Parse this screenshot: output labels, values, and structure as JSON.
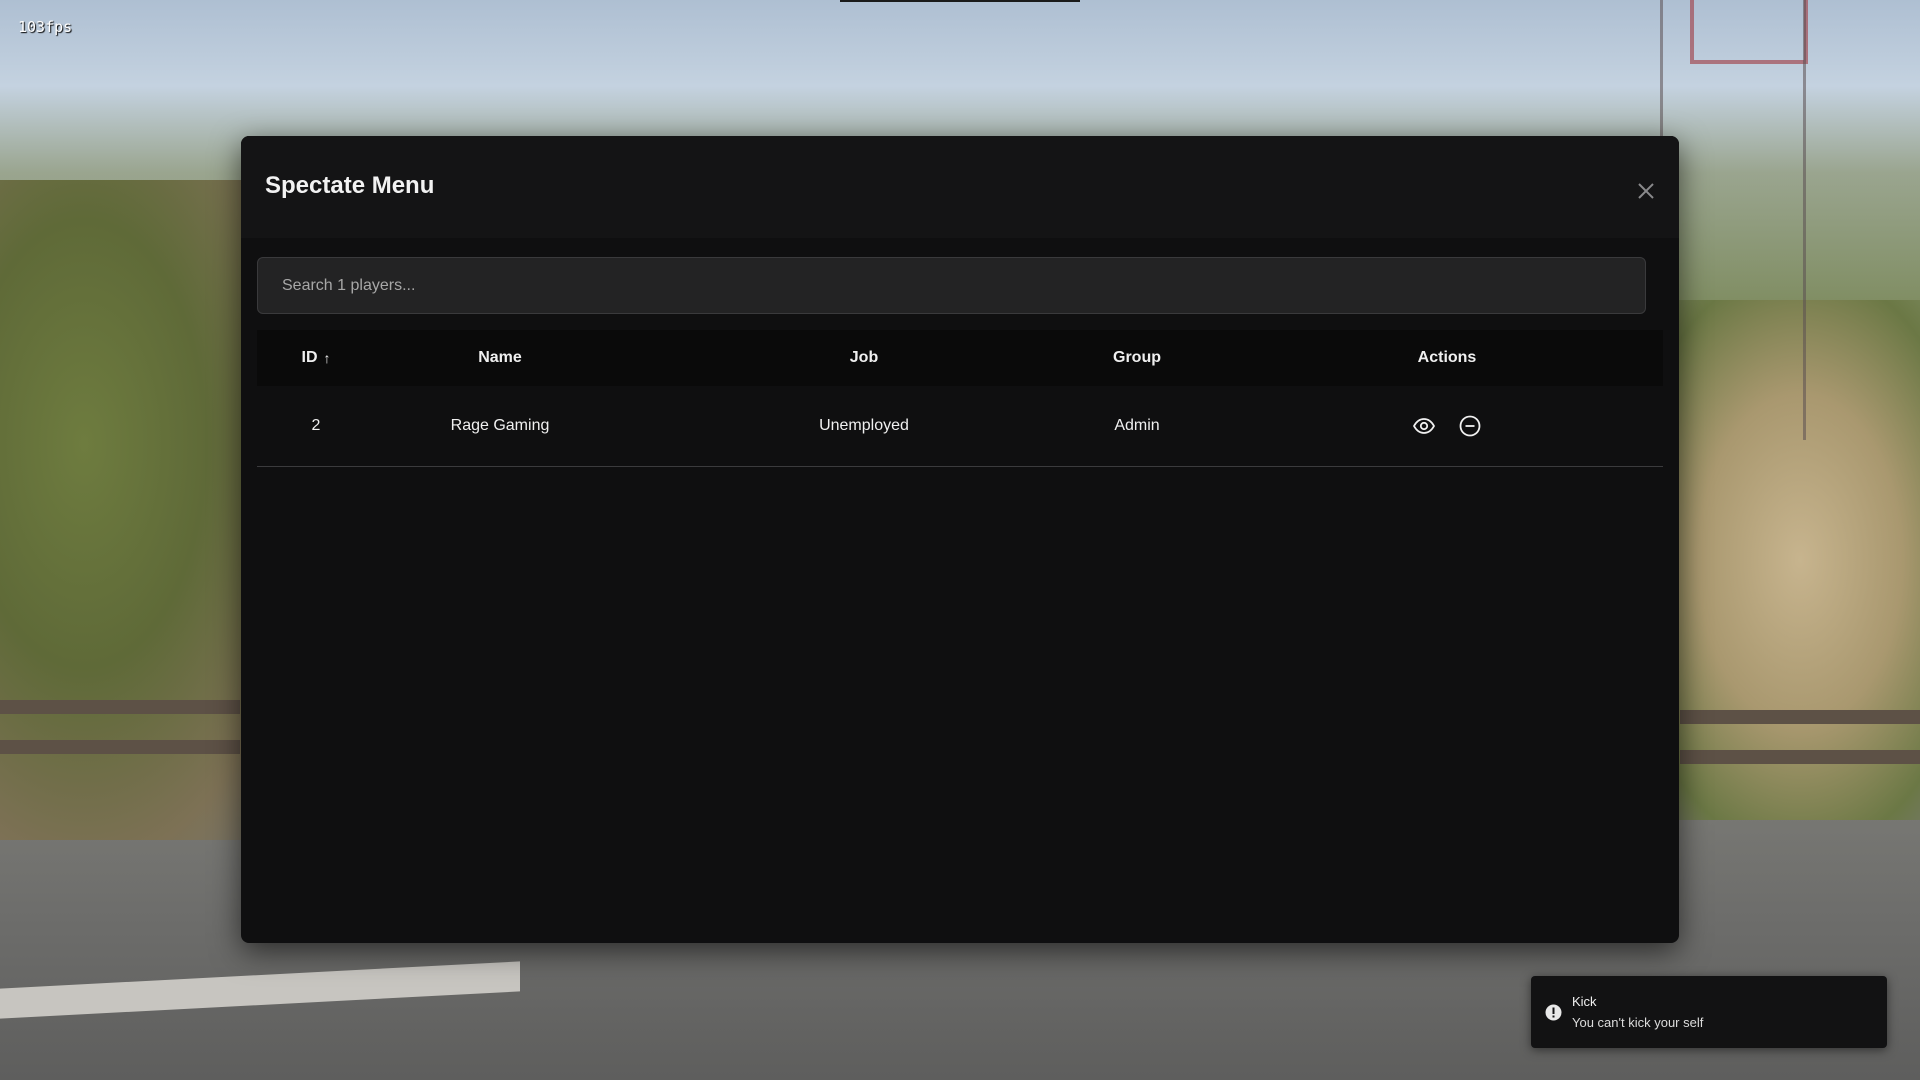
{
  "hud": {
    "fps": "103fps"
  },
  "modal": {
    "title": "Spectate Menu",
    "search_placeholder": "Search 1 players...",
    "columns": {
      "id": "ID",
      "id_sort_indicator": "↑",
      "name": "Name",
      "job": "Job",
      "group": "Group",
      "actions": "Actions"
    },
    "rows": [
      {
        "id": "2",
        "name": "Rage Gaming",
        "job": "Unemployed",
        "group": "Admin"
      }
    ],
    "row_actions": [
      "eye-icon",
      "minus-circle-icon"
    ],
    "close_icon": "close-icon"
  },
  "toast": {
    "icon": "alert-circle-icon",
    "title": "Kick",
    "message": "You can't kick your self"
  },
  "colors": {
    "modal_bg": "#0f0f10",
    "header_bg": "#141415",
    "search_bg": "#232324",
    "table_header_bg": "#0a0a0a",
    "text": "#f0f0f0",
    "toast_bg": "#121213"
  }
}
